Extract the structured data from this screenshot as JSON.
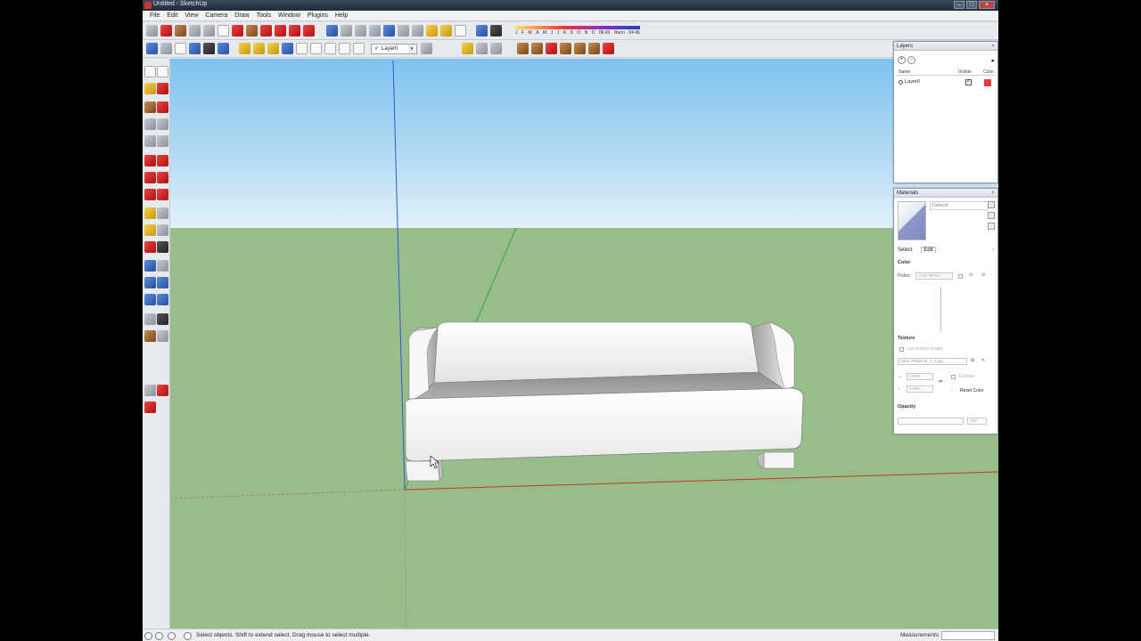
{
  "window": {
    "title": "Untitled - SketchUp"
  },
  "menubar": {
    "items": [
      "File",
      "Edit",
      "View",
      "Camera",
      "Draw",
      "Tools",
      "Window",
      "Plugins",
      "Help"
    ]
  },
  "toolbar": {
    "layer_selected": "Layer0",
    "shadow_time_labels": [
      "J",
      "F",
      "M",
      "A",
      "M",
      "J",
      "J",
      "A",
      "S",
      "O",
      "N",
      "D"
    ],
    "shadow_time_start": "06:43",
    "shadow_time_mid": "Noon",
    "shadow_time_end": "04:46"
  },
  "layers_panel": {
    "title": "Layers",
    "col_name": "Name",
    "col_visible": "Visible",
    "col_color": "Color",
    "rows": [
      {
        "name": "Layer0",
        "visible": true,
        "color": "#e23b3b"
      }
    ]
  },
  "materials_panel": {
    "title": "Materials",
    "material_name": "Default",
    "tab_select": "Select",
    "tab_edit": "Edit",
    "color_section": "Color",
    "picker_label": "Picker:",
    "picker_value": "Color Wheel",
    "texture_section": "Texture",
    "use_texture_label": "Use texture image",
    "texture_file": "FabricPlaid01B_2_3.jpg",
    "width_value": "1.00m",
    "height_value": "1.00m",
    "colorize_label": "Colorize",
    "reset_color_label": "Reset Color",
    "opacity_section": "Opacity",
    "opacity_value": "100"
  },
  "statusbar": {
    "hint": "Select objects. Shift to extend select. Drag mouse to select multiple.",
    "measurements_label": "Measurements"
  },
  "colors": {
    "sky_top": "#7ec3ee",
    "ground": "#97bd8a",
    "axis_red": "#c0392b",
    "axis_green": "#2e9d3a",
    "axis_blue": "#2a5bd7"
  }
}
